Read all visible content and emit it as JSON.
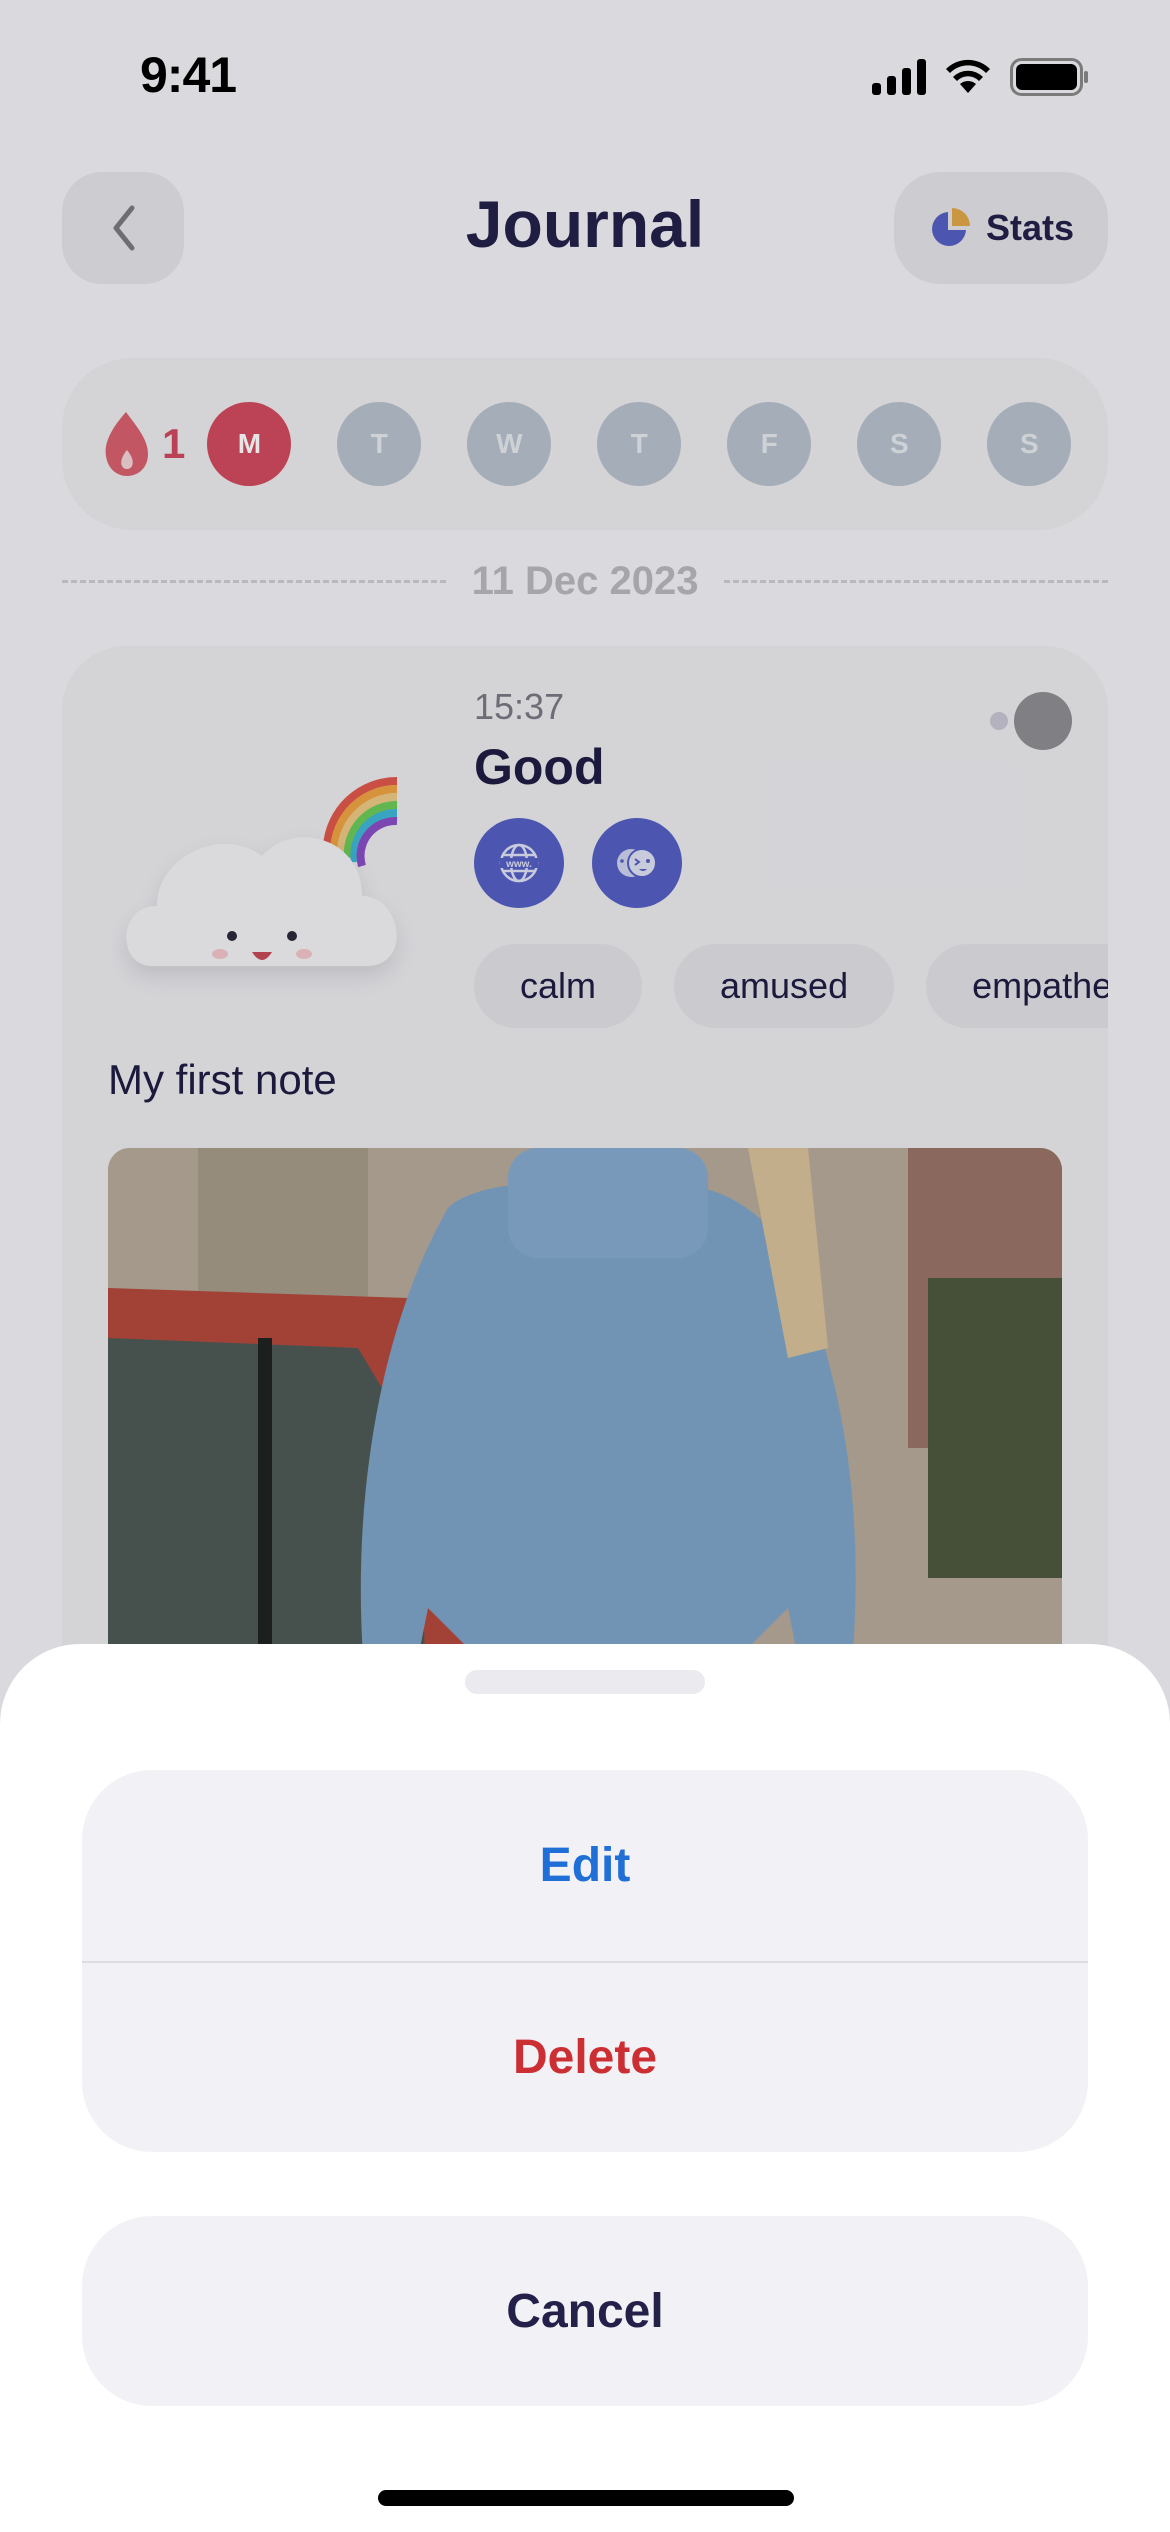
{
  "status_bar": {
    "time": "9:41",
    "icons": [
      "cellular-signal-icon",
      "wifi-icon",
      "battery-icon"
    ]
  },
  "header": {
    "back_icon": "chevron-left-icon",
    "title": "Journal",
    "stats_button": {
      "label": "Stats",
      "icon": "pie-chart-icon"
    }
  },
  "week_strip": {
    "streak": {
      "icon": "flame-icon",
      "count": "1"
    },
    "days": [
      {
        "label": "M",
        "active": true
      },
      {
        "label": "T",
        "active": false
      },
      {
        "label": "W",
        "active": false
      },
      {
        "label": "T",
        "active": false
      },
      {
        "label": "F",
        "active": false
      },
      {
        "label": "S",
        "active": false
      },
      {
        "label": "S",
        "active": false
      }
    ]
  },
  "date_separator": "11 Dec 2023",
  "entry": {
    "mood_illustration": "happy-cloud-rainbow-icon",
    "time": "15:37",
    "mood": "Good",
    "activity_icons": [
      "globe-www-icon",
      "friends-faces-icon"
    ],
    "emotion_tags": [
      "calm",
      "amused",
      "empathetic"
    ],
    "note_title": "My first note",
    "photo": "photo of woman in blue turtleneck sweater next to red car",
    "more_icon": "more-options-icon"
  },
  "action_sheet": {
    "options": [
      {
        "label": "Edit",
        "color": "#1f6fd6"
      },
      {
        "label": "Delete",
        "color": "#cc2f33"
      }
    ],
    "cancel_label": "Cancel"
  },
  "colors": {
    "primary_text": "#23214a",
    "accent_red": "#d24b5f",
    "accent_indigo": "#5560c6",
    "inactive_day": "#b7c1cd"
  }
}
